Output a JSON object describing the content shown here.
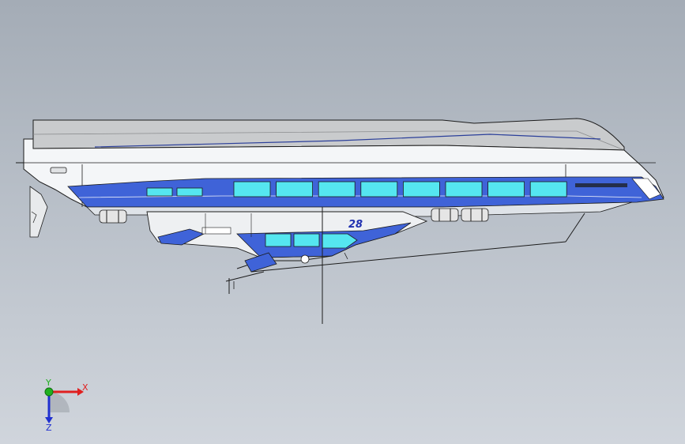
{
  "model": {
    "hull_number": "28",
    "colors": {
      "background_top": "#a4acb6",
      "background_bottom": "#d0d5dc",
      "hull_white": "#f4f6f8",
      "hull_blue": "#3f63d8",
      "window_cyan": "#55e6f0",
      "roof_grey": "#c9cbcd",
      "outline": "#1c1c1c"
    }
  },
  "triad": {
    "x_label": "X",
    "y_label": "Y",
    "z_label": "Z",
    "colors": {
      "x": "#e02020",
      "y": "#20b020",
      "z": "#2030d0"
    }
  }
}
